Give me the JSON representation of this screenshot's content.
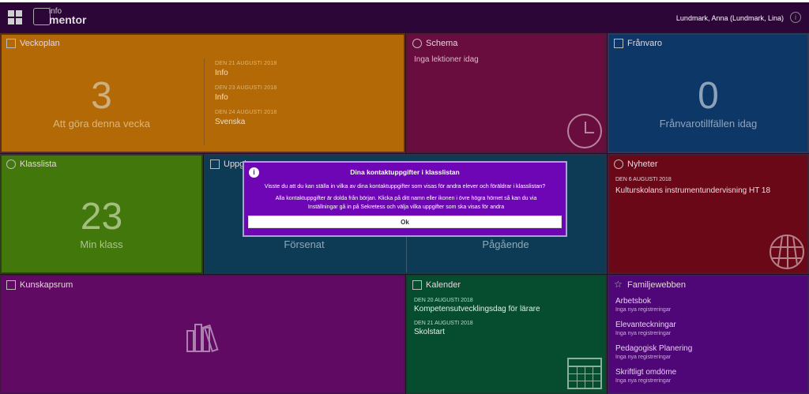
{
  "header": {
    "logo_small": "info",
    "logo_big": "mentor",
    "user": "Lundmark, Anna (Lundmark, Lina)"
  },
  "tiles": {
    "veckoplan": {
      "title": "Veckoplan",
      "count": "3",
      "count_label": "Att göra denna vecka",
      "events": [
        {
          "date": "DEN 21 AUGUSTI 2018",
          "title": "Info"
        },
        {
          "date": "DEN 23 AUGUSTI 2018",
          "title": "Info"
        },
        {
          "date": "DEN 24 AUGUSTI 2018",
          "title": "Svenska"
        }
      ]
    },
    "schema": {
      "title": "Schema",
      "message": "Inga lektioner idag"
    },
    "franvaro": {
      "title": "Frånvaro",
      "count": "0",
      "count_label": "Frånvarotillfällen idag"
    },
    "klasslista": {
      "title": "Klasslista",
      "count": "23",
      "count_label": "Min klass"
    },
    "uppgifter": {
      "title": "Uppgi",
      "late_label": "Försenat",
      "ongoing_label": "Pågående"
    },
    "nyheter": {
      "title": "Nyheter",
      "date": "DEN 6 AUGUSTI 2018",
      "headline": "Kulturskolans instrumentundervisning HT 18"
    },
    "kunskapsrum": {
      "title": "Kunskapsrum"
    },
    "kalender": {
      "title": "Kalender",
      "events": [
        {
          "date": "DEN 20 AUGUSTI 2018",
          "title": "Kompetensutvecklingsdag för lärare"
        },
        {
          "date": "DEN 21 AUGUSTI 2018",
          "title": "Skolstart"
        }
      ]
    },
    "familjewebben": {
      "title": "Familjewebben",
      "items": [
        {
          "title": "Arbetsbok",
          "sub": "Inga nya registreringar"
        },
        {
          "title": "Elevanteckningar",
          "sub": "Inga nya registreringar"
        },
        {
          "title": "Pedagogisk Planering",
          "sub": "Inga nya registreringar"
        },
        {
          "title": "Skriftligt omdöme",
          "sub": "Inga nya registreringar"
        }
      ]
    }
  },
  "modal": {
    "title": "Dina kontaktuppgifter i klasslistan",
    "question": "Visste du att du kan ställa in vilka av dina kontaktuppgifter som visas för andra elever och föräldrar i klasslistan?",
    "body": "Alla kontaktuppgifter är dolda från början. Klicka på ditt namn eller ikonen i övre högra hörnet så kan du via Inställningar gå in på Sekretess och välja vilka uppgifter som ska visas för andra",
    "ok_label": "Ok"
  }
}
